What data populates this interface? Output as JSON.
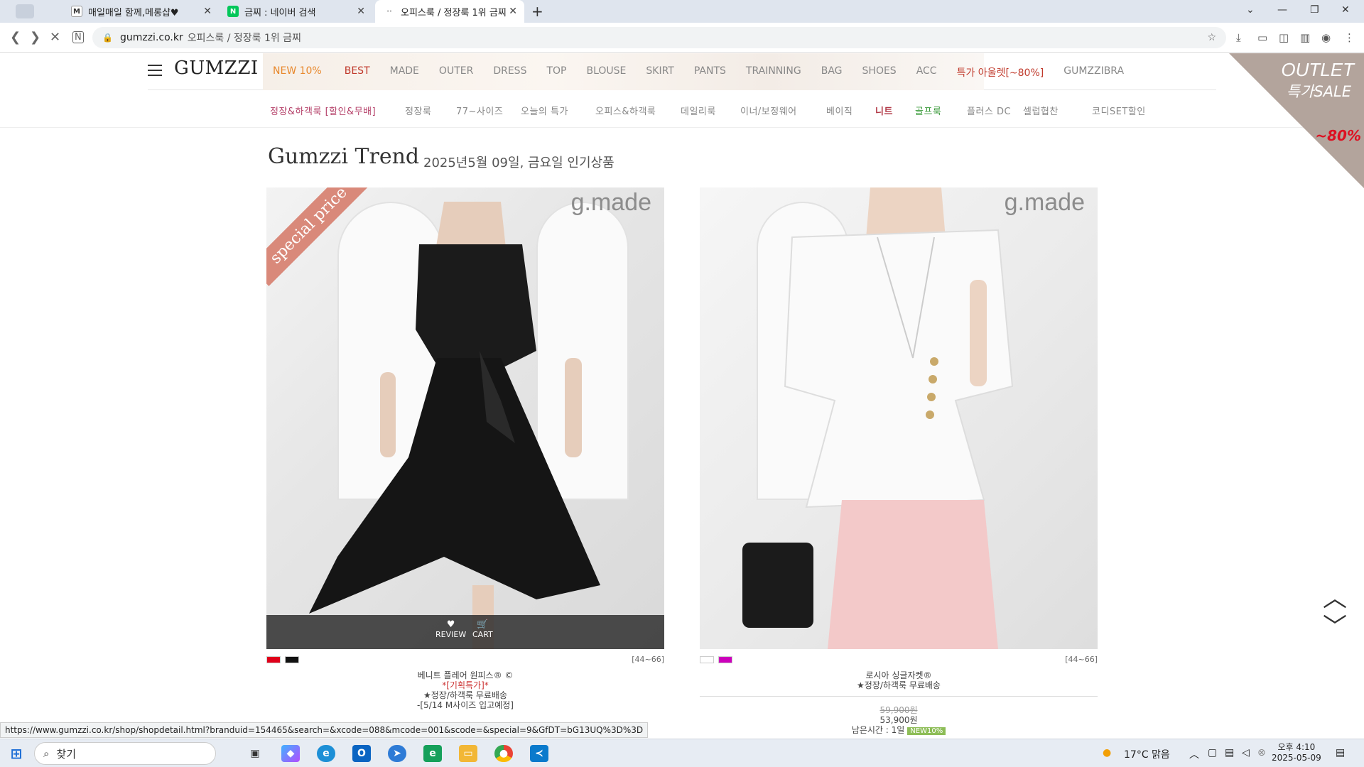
{
  "browser": {
    "tabs": [
      {
        "label": "매일매일 함께,메롱샵♥"
      },
      {
        "label": "금찌 : 네이버 검색"
      },
      {
        "label": "오피스룩 / 정장룩 1위 금찌"
      }
    ],
    "url": "gumzzi.co.kr",
    "page_title": "오피스룩 / 정장룩 1위 금찌",
    "status_url": "https://www.gumzzi.co.kr/shop/shopdetail.html?branduid=154465&search=&xcode=088&mcode=001&scode=&special=9&GfDT=bG13UQ%3D%3D"
  },
  "site": {
    "logo": "GUMZZI",
    "menu": [
      "NEW 10%",
      "BEST",
      "MADE",
      "OUTER",
      "DRESS",
      "TOP",
      "BLOUSE",
      "SKIRT",
      "PANTS",
      "TRAINNING",
      "BAG",
      "SHOES",
      "ACC",
      "특가 아울렛[~80%]",
      "GUMZZIBRA"
    ],
    "subnav": [
      "정장&하객룩 [할인&무배]",
      "정장룩",
      "77~사이즈",
      "오늘의 특가",
      "오피스&하객룩",
      "데일리룩",
      "이너/보정웨어",
      "베이직",
      "니트",
      "골프룩",
      "플러스 DC",
      "셀럽협찬",
      "코디SET할인"
    ],
    "outlet": {
      "line1": "OUTLET",
      "line2": "특가SALE",
      "line3": "~80%"
    }
  },
  "trend": {
    "title": "Gumzzi Trend",
    "subtitle": "2025년5월 09일, 금요일  인기상품"
  },
  "products": [
    {
      "brand_mark": "g.made",
      "ribbon": "special price",
      "review": "REVIEW",
      "cart": "CART",
      "size": "[44~66]",
      "colors": [
        "#e0001a",
        "#111111"
      ],
      "name": "베니트 플레어 원피스® ©",
      "line2": "*[기획특가]*",
      "line3": "★정장/하객룩 무료배송",
      "line4": "-[5/14 M사이즈 입고예정]"
    },
    {
      "brand_mark": "g.made",
      "size": "[44~66]",
      "colors": [
        "#ffffff",
        "#cc00bb"
      ],
      "name": "로시아 싱글자켓®",
      "line2": "★정장/하객룩 무료배송",
      "price_old": "59,900원",
      "price_new": "53,900원",
      "remaining": "남은시간 : 1일",
      "badge": "NEW10%"
    }
  ],
  "taskbar": {
    "search": "찾기",
    "weather": "17°C  맑음",
    "time": "오후 4:10",
    "date": "2025-05-09"
  },
  "colors": {
    "accent_orange": "#e8882c",
    "accent_red": "#c0392b",
    "outlet_bg": "#b3a49c",
    "badge_green": "#8dbd57"
  }
}
